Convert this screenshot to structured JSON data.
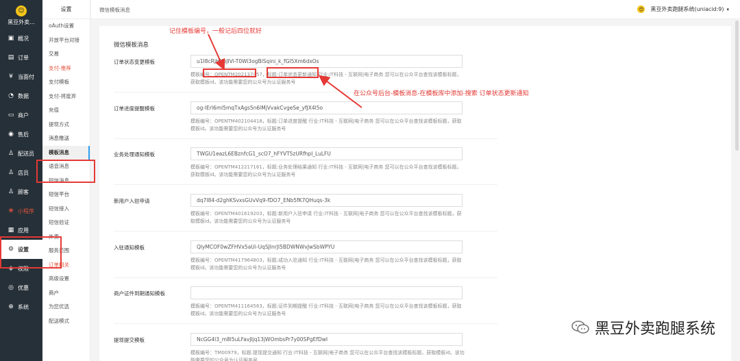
{
  "nav": {
    "logo_badge": "😊",
    "logo_name": "黑豆外卖...",
    "items": [
      {
        "icon": "▣",
        "label": "概况"
      },
      {
        "icon": "▤",
        "label": "订单"
      },
      {
        "icon": "¥",
        "label": "当面付"
      },
      {
        "icon": "◔",
        "label": "数据"
      },
      {
        "icon": "▭",
        "label": "商户"
      },
      {
        "icon": "◉",
        "label": "售后"
      },
      {
        "icon": "♙",
        "label": "配送员"
      },
      {
        "icon": "♙",
        "label": "店员"
      },
      {
        "icon": "♙",
        "label": "顾客"
      },
      {
        "icon": "❀",
        "label": "小程序"
      },
      {
        "icon": "▦",
        "label": "应用"
      },
      {
        "icon": "⚙",
        "label": "设置"
      },
      {
        "icon": "◈",
        "label": "权限"
      },
      {
        "icon": "◎",
        "label": "优惠"
      },
      {
        "icon": "⊕",
        "label": "系统"
      }
    ]
  },
  "sub": {
    "head": "设置",
    "items": [
      "oAuth设置",
      "开放平台对接",
      "交易",
      "支付-推荐",
      "支付模板",
      "支付-将废弃",
      "充值",
      "提现方式",
      "消息推送",
      "模板消息",
      "语音消息",
      "短信消息",
      "短信平台",
      "短信接入",
      "短信验证",
      "外卖",
      "服务范围",
      "订单相关",
      "高级设置",
      "商户",
      "为您优选",
      "配送模式"
    ]
  },
  "topbar": {
    "title": "微信模板消息",
    "account_badge": "😊",
    "account": "黑豆外卖跑腿系统(uniacid:9)",
    "caret": "▾"
  },
  "card": {
    "title": "微信模板消息",
    "rows": [
      {
        "label": "订单状态变更模板",
        "value": "u1I8cRjHKbJIVi-T0Wi3ogBiSqini_k_fGl5Xm6dxOs",
        "help": "模板编号：OPENTM202137457，标题:订单状态更新通知  行业:IT科技 - 互联网|电子商务  您可以在公众平台查找该模板标题，获取模板id。该功能需要您的公众号为认证服务号"
      },
      {
        "label": "订单进度提醒模板",
        "value": "og-lErl6ml5mqTxAgs5n6lMjVvakCvgeSe_yfJX4l5o",
        "help": "模板编号：OPENTM402104418，标题:订单进度提醒  行业:IT科技 - 互联网|电子商务  您可以在公众平台查找该模板标题，获取模板id。该功能需要您的公众号为认证服务号"
      },
      {
        "label": "业务处理通知模板",
        "value": "TWGU1eazL6EBznfcG1_scO7_hFYVT5zURfhpl_LuLFU",
        "help": "模板编号：OPENTM412217161，标题:业务处理结果通知  行业:IT科技 - 互联网|电子商务  您可以在公众平台查找该模板标题，获取模板id。该功能需要您的公众号为认证服务号"
      },
      {
        "label": "新用户入驻申请",
        "value": "dq7I84-d2ghKSvxsGUvVq9-fDO7_ENb5fK7QHuqs-3k",
        "help": "模板编号：OPENTM401619203，标题:新用户入驻申请  行业:IT科技 - 互联网|电子商务  您可以在公众平台查找该模板标题，获取模板id。该功能需要您的公众号为认证服务号"
      },
      {
        "label": "入驻通知模板",
        "value": "QlyMCOF0wZFHVx5aUi-UqSJInrJl5BDWNWvJwSbWPYU",
        "help": "模板编号：OPENTM417964803，标题:成功入驻通知  行业:IT科技 - 互联网|电子商务  您可以在公众平台查找该模板标题，获取模板id。该功能需要您的公众号为认证服务号"
      },
      {
        "label": "商户证件到期通知模板",
        "value": "",
        "help": "模板编号：OPENTM411164563，标题:证件到期提醒  行业:IT科技 - 互联网|电子商务  您可以在公众平台查找该模板标题，获取模板id。该功能需要您的公众号为认证服务号"
      },
      {
        "label": "提现提交模板",
        "value": "NcGG4l3_m8l5uLFavJljq13jWOmbsPr7y00SPgEfDwI",
        "help": "模板编号：TM00979，标题:提现提交通知  行业:IT科技 - 互联网|电子商务  您可以在公众平台查找该模板标题，获取模板id。该功能需要您的公众号为认证服务号"
      }
    ]
  },
  "annotations": {
    "top_note": "记住模板编号，一般记后四位就好",
    "right_note": "在公众号后台-模板消息-在模板库中添加-搜索 订单状态更新通知"
  },
  "watermark": "黑豆外卖跑腿系统"
}
